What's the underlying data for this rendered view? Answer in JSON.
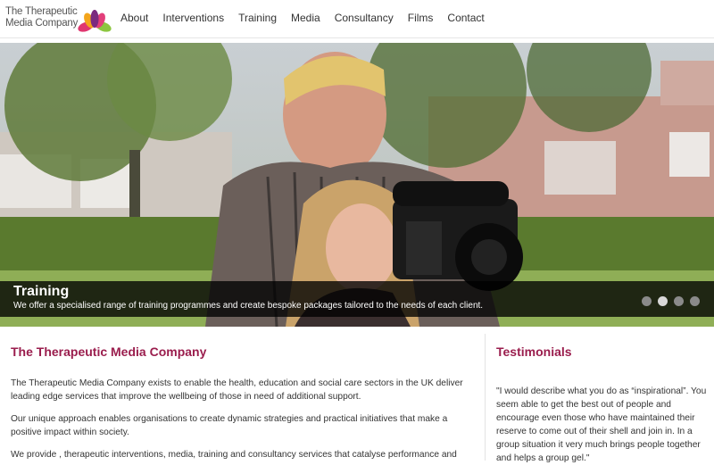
{
  "logo": {
    "line1": "The Therapeutic",
    "line2": "Media Company"
  },
  "nav": {
    "items": [
      "About",
      "Interventions",
      "Training",
      "Media",
      "Consultancy",
      "Films",
      "Contact"
    ]
  },
  "slider": {
    "title": "Training",
    "text": "We offer a specialised range of training programmes and create bespoke packages tailored to the needs of each client.",
    "slide_count": 4,
    "active_index": 1
  },
  "main": {
    "heading": "The Therapeutic Media Company",
    "paragraphs": [
      "The Therapeutic Media Company exists to enable the health, education and social care sectors in the UK deliver leading edge services that improve the wellbeing of those in need of additional support.",
      "Our unique approach enables organisations to create dynamic strategies and practical initiatives that make a positive impact within society.",
      "We provide , therapeutic interventions, media, training and consultancy services that catalyse performance and"
    ]
  },
  "testimonials": {
    "heading": "Testimonials",
    "quote": "\"I would describe what you do as “inspirational”. You seem able to get the best out of people and encourage even those who have maintained their reserve to come out of their shell and join in. In a group situation it very much brings people together and helps a group gel.\""
  },
  "colors": {
    "accent": "#9a1d4d",
    "caption_bg": "#000000"
  }
}
